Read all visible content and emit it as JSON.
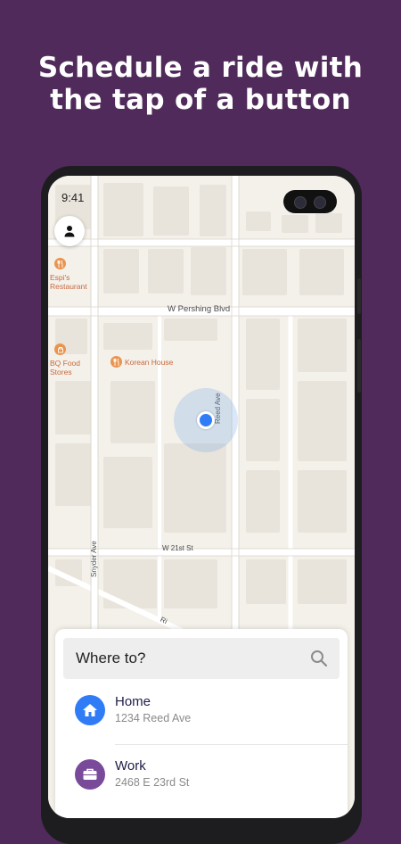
{
  "headline": {
    "line1": "Schedule a ride with",
    "line2": "the tap of a button"
  },
  "status_bar": {
    "time": "9:41"
  },
  "map": {
    "roads": {
      "pershing": "W Pershing Blvd",
      "reed": "Reed Ave",
      "w21st": "W 21st St",
      "snyder": "Snyder Ave",
      "diagonal": "Ri"
    },
    "pois": [
      {
        "name_line1": "Espi's",
        "name_line2": "Restaurant",
        "icon": "fork-knife-icon"
      },
      {
        "name_line1": "BQ Food",
        "name_line2": "Stores",
        "icon": "shop-icon"
      },
      {
        "name": "Korean House",
        "icon": "fork-knife-icon"
      }
    ],
    "colors": {
      "background": "#f4f1ea",
      "poi": "#e9944f",
      "location_dot": "#2f7cf6"
    }
  },
  "sheet": {
    "search_placeholder": "Where to?",
    "places": [
      {
        "title": "Home",
        "address": "1234 Reed Ave",
        "icon": "home-icon",
        "color": "#2f7cf6"
      },
      {
        "title": "Work",
        "address": "2468 E 23rd St",
        "icon": "briefcase-icon",
        "color": "#7a4a9a"
      }
    ]
  },
  "colors": {
    "page_background": "#4f2a5a",
    "headline_text": "#ffffff"
  }
}
